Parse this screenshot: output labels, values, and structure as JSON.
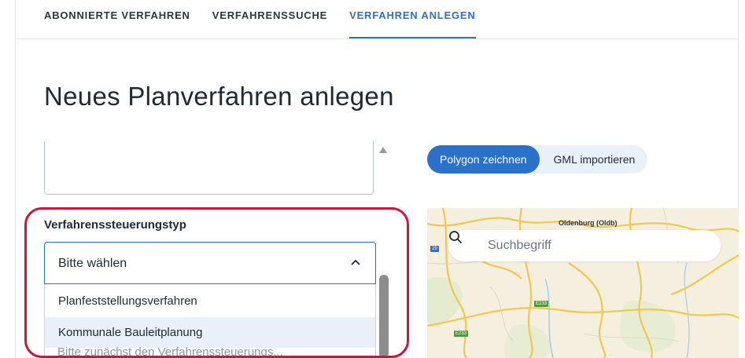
{
  "tabs": [
    {
      "label": "ABONNIERTE VERFAHREN",
      "active": false
    },
    {
      "label": "VERFAHRENSSUCHE",
      "active": false
    },
    {
      "label": "VERFAHREN ANLEGEN",
      "active": true
    }
  ],
  "page": {
    "title": "Neues Planverfahren anlegen"
  },
  "form": {
    "select_label": "Verfahrenssteuerungstyp",
    "select_value": "Bitte wählen",
    "options": [
      {
        "label": "Planfeststellungsverfahren",
        "highlighted": false
      },
      {
        "label": "Kommunale Bauleitplanung",
        "highlighted": true
      }
    ],
    "hint": "Bitte zunächst den Verfahrenssteuerungs..."
  },
  "map_tools": {
    "draw_polygon": "Polygon zeichnen",
    "import_gml": "GML importieren",
    "active": "draw_polygon"
  },
  "map": {
    "search_placeholder": "Suchbegriff",
    "city_label": "Oldenburg (Oldb)",
    "road_labels": [
      "29",
      "E233",
      "E233"
    ]
  },
  "colors": {
    "accent": "#2a72c9",
    "highlight_border": "#d0143a",
    "option_hover": "#e9f0f9"
  },
  "icons": [
    "search-icon",
    "chevron-up-icon",
    "scroll-up-arrow-icon"
  ]
}
